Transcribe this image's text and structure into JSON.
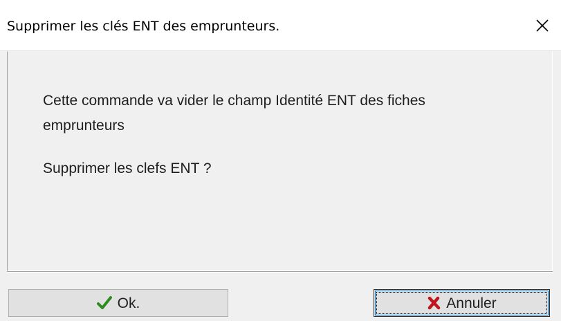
{
  "window": {
    "title": "Supprimer les clés ENT des emprunteurs.",
    "close_icon": "close-icon"
  },
  "message": {
    "line1": "Cette commande va vider le champ Identité ENT des fiches",
    "line2": "emprunteurs",
    "question": "Supprimer les clefs ENT ?"
  },
  "buttons": {
    "ok_label": "Ok.",
    "ok_icon": "checkmark-icon",
    "cancel_label": "Annuler",
    "cancel_icon": "x-cross-icon"
  },
  "colors": {
    "dialog_bg": "#f0f0f0",
    "titlebar_bg": "#ffffff",
    "ok_icon": "#2e8b1e",
    "cancel_icon": "#c0141e"
  }
}
